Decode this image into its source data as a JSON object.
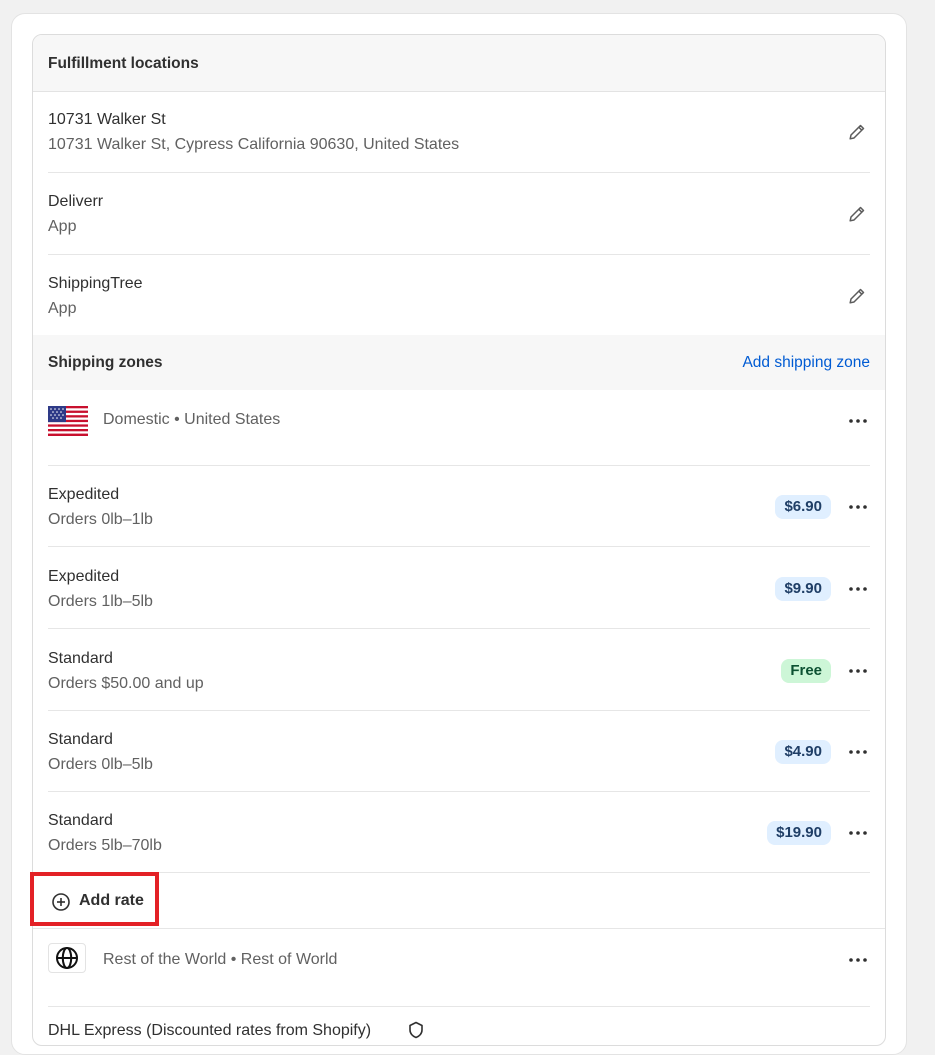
{
  "fulfillment": {
    "title": "Fulfillment locations",
    "locations": [
      {
        "name": "10731 Walker St",
        "detail": "10731 Walker St, Cypress California 90630, United States"
      },
      {
        "name": "Deliverr",
        "detail": "App"
      },
      {
        "name": "ShippingTree",
        "detail": "App"
      }
    ]
  },
  "shipping_zones": {
    "title": "Shipping zones",
    "add_zone_label": "Add shipping zone",
    "domestic": {
      "label": "Domestic • United States",
      "flag_icon": "us-flag-icon",
      "rates": [
        {
          "name": "Expedited",
          "condition": "Orders 0lb–1lb",
          "price": "$6.90",
          "kind": "price"
        },
        {
          "name": "Expedited",
          "condition": "Orders 1lb–5lb",
          "price": "$9.90",
          "kind": "price"
        },
        {
          "name": "Standard",
          "condition": "Orders $50.00 and up",
          "price": "Free",
          "kind": "free"
        },
        {
          "name": "Standard",
          "condition": "Orders 0lb–5lb",
          "price": "$4.90",
          "kind": "price"
        },
        {
          "name": "Standard",
          "condition": "Orders 5lb–70lb",
          "price": "$19.90",
          "kind": "price"
        }
      ],
      "add_rate_label": "Add rate"
    },
    "rest_of_world": {
      "label": "Rest of the World • Rest of World",
      "globe_icon": "globe-icon",
      "partial_row": "DHL Express (Discounted rates from Shopify)"
    }
  },
  "colors": {
    "link": "#005bd3",
    "highlight_border": "#e32126",
    "price_badge_bg": "#e0efff",
    "free_badge_bg": "#cdf6d7"
  }
}
